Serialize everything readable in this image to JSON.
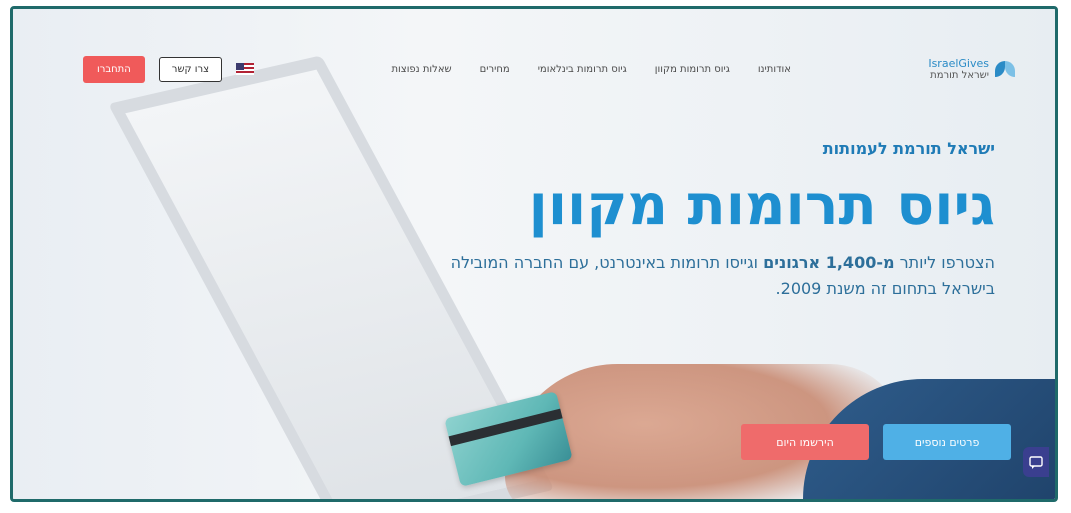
{
  "brand": {
    "name_en": "IsraelGives",
    "name_he": "ישראל תורמת"
  },
  "nav": {
    "links": [
      "אודותינו",
      "גיוס תרומות מקוון",
      "גיוס תרומות בינלאומי",
      "מחירים",
      "שאלות נפוצות"
    ],
    "contact_label": "צרו קשר",
    "login_label": "התחברו"
  },
  "hero": {
    "eyebrow": "ישראל תורמת לעמותות",
    "headline": "גיוס תרומות מקוון",
    "subtext_part1": "הצטרפו ליותר ",
    "subtext_bold": "מ-1,400 ארגונים",
    "subtext_part2": " וגייסו תרומות באינטרנט, עם החברה המובילה בישראל בתחום זה משנת 2009."
  },
  "cta": {
    "register_label": "הירשמו היום",
    "details_label": "פרטים נוספים"
  },
  "colors": {
    "brand_blue": "#1e8fd0",
    "cta_red": "#ef6b6b",
    "cta_blue": "#4fb0e6",
    "frame": "#1f6a6a"
  }
}
